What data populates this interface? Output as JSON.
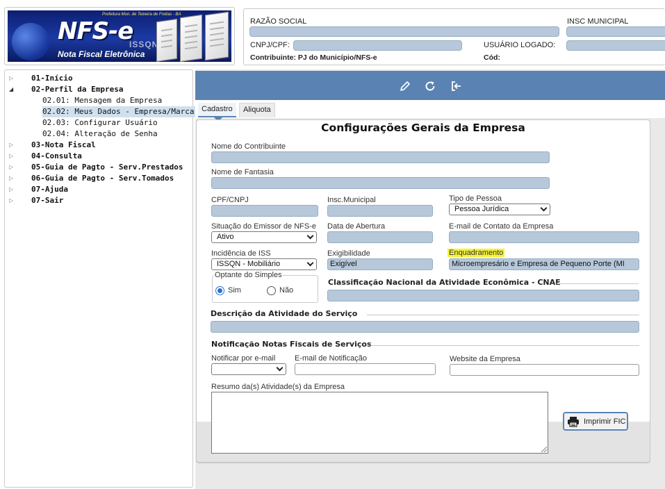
{
  "header": {
    "logo": {
      "top_text": "Prefeitura Mun. de Teixeira de Freitas - BA",
      "title": "NFS-e",
      "subtitle": "Nota Fiscal Eletrônica",
      "issqn": "ISSQN"
    },
    "info": {
      "razao_social_label": "RAZÃO SOCIAL",
      "insc_municipal_label": "INSC MUNICIPAL",
      "cnpj_label": "CNPJ/CPF:",
      "usuario_label": "USUÁRIO LOGADO:",
      "contribuinte_label": "Contribuinte: PJ do Município/NFS-e",
      "cod_label": "Cód:"
    }
  },
  "sidebar": {
    "items": [
      {
        "label": "01-Início",
        "expanded": false
      },
      {
        "label": "02-Perfil da Empresa",
        "expanded": true
      },
      {
        "label": "02.01: Mensagem da Empresa"
      },
      {
        "label": "02.02: Meus Dados - Empresa/Marca"
      },
      {
        "label": "02.03: Configurar Usuário"
      },
      {
        "label": "02.04: Alteração de Senha"
      },
      {
        "label": "03-Nota Fiscal",
        "expanded": false
      },
      {
        "label": "04-Consulta",
        "expanded": false
      },
      {
        "label": "05-Guia de Pagto - Serv.Prestados",
        "expanded": false
      },
      {
        "label": "06-Guia de Pagto - Serv.Tomados",
        "expanded": false
      },
      {
        "label": "07-Ajuda",
        "expanded": false
      },
      {
        "label": "07-Sair",
        "expanded": false
      }
    ],
    "selected": "02.02: Meus Dados - Empresa/Marca"
  },
  "toolbar": {
    "icons": [
      "pencil-icon",
      "refresh-icon",
      "exit-icon"
    ],
    "color": "#5a83b4"
  },
  "tabs": [
    {
      "label": "Cadastro",
      "active": true
    },
    {
      "label": "Aliquota",
      "active": false
    }
  ],
  "form": {
    "title": "Configurações Gerais da Empresa",
    "nome_contribuinte_label": "Nome do Contribuinte",
    "nome_fantasia_label": "Nome de Fantasia",
    "cpf_cnpj_label": "CPF/CNPJ",
    "insc_municipal_label": "Insc.Municipal",
    "tipo_pessoa_label": "Tipo de Pessoa",
    "tipo_pessoa_value": "Pessoa Jurídica",
    "situacao_label": "Situação do Emissor de NFS-e",
    "situacao_value": "Ativo",
    "data_abertura_label": "Data de Abertura",
    "email_contato_label": "E-mail de Contato da Empresa",
    "incidencia_label": "Incidência de ISS",
    "incidencia_value": "ISSQN - Mobiliário",
    "exigibilidade_label": "Exigibilidade",
    "exigibilidade_value": "Exigível",
    "enquadramento_label": "Enquadramento",
    "enquadramento_value": "Microempresário e Empresa de Pequeno Porte (MI",
    "optante_label": "Optante do Simples",
    "optante_sim": "Sim",
    "optante_nao": "Não",
    "optante_selected": "Sim",
    "cnae_label": "Classificação Nacional da Atividade Econômica - CNAE",
    "descricao_label": "Descrição da Atividade do Serviço",
    "notificacao_label": "Notificação Notas Fiscais de Serviços",
    "notificar_label": "Notificar por e-mail",
    "notificar_value": "",
    "email_notificacao_label": "E-mail de Notificação",
    "website_label": "Website da Empresa",
    "resumo_label": "Resumo da(s) Atividade(s) da Empresa",
    "imprimir_label": "Imprimir FIC"
  },
  "colors": {
    "accent": "#5a83b4",
    "field_fill": "#b6c8d9",
    "highlight": "#f4f13a",
    "selected_nav": "#cfe0ee"
  }
}
